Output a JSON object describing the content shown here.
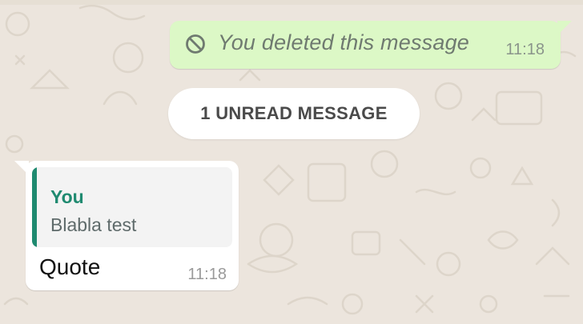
{
  "chat": {
    "messages": [
      {
        "direction": "outgoing",
        "icon": "prohibited-icon",
        "text": "You deleted this message",
        "time": "11:18"
      },
      {
        "direction": "incoming",
        "quote": {
          "author": "You",
          "text": "Blabla test"
        },
        "text": "Quote",
        "time": "11:18"
      }
    ],
    "unread_separator": "1 UNREAD MESSAGE"
  },
  "colors": {
    "background": "#ece5dd",
    "outgoing_bubble": "#dcf8c6",
    "incoming_bubble": "#ffffff",
    "quote_accent": "#1f8a70"
  }
}
